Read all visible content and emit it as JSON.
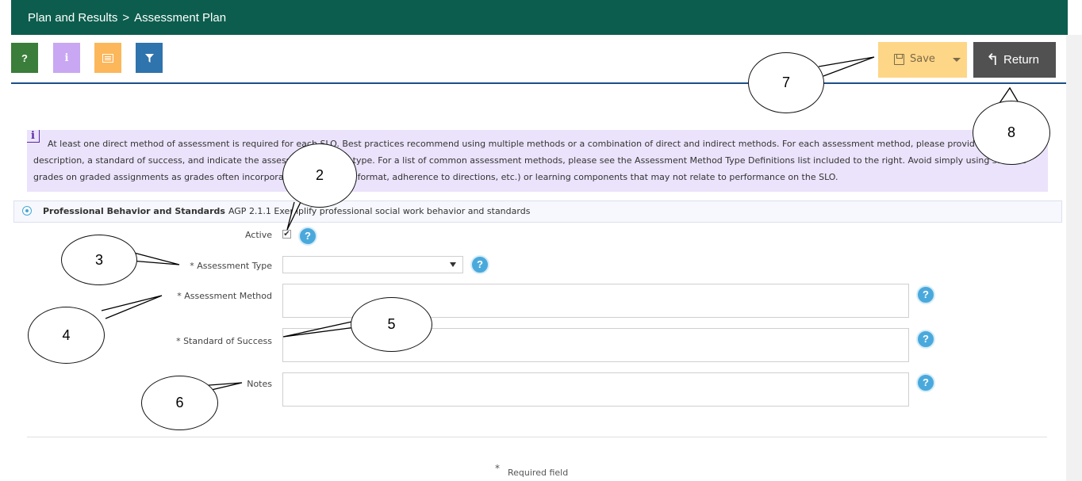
{
  "header": {
    "breadcrumb": [
      "Plan and Results",
      "Assessment Plan"
    ],
    "separator": ">"
  },
  "toolbar": {
    "help_label": "?",
    "info_label": "i",
    "list_icon": "list-icon",
    "filter_icon": "filter-icon",
    "save_label": "Save",
    "return_label": "Return"
  },
  "info": {
    "text": "At least one direct method of assessment is required for each SLO. Best practices recommend using multiple methods or a combination of direct and indirect methods. For each assessment method, please provide a detailed description, a standard of success, and indicate the assessment method type. For a list of common assessment methods, please see the Assessment Method Type Definitions list included to the right. Avoid simply using student grades on graded assignments as grades often incorporate other factors (format, adherence to directions, etc.) or learning components that may not relate to performance on the SLO."
  },
  "slo": {
    "name": "Professional Behavior and Standards",
    "description": "AGP 2.1.1 Exemplify professional social work behavior and standards"
  },
  "form": {
    "active_label": "Active",
    "active_checked": true,
    "assessment_type_label": "* Assessment Type",
    "assessment_type_value": "",
    "assessment_method_label": "Assessment Method",
    "assessment_method_star": "*",
    "standard_label": "* Standard of Success",
    "notes_label": "Notes",
    "help_glyph": "?",
    "required_note": "Required field",
    "required_star": "*"
  },
  "callouts": [
    "2",
    "3",
    "4",
    "5",
    "6",
    "7",
    "8"
  ],
  "colors": {
    "header": "#0c5d4d",
    "help_button": "#3b7d3a",
    "info_button": "#c9a7f2",
    "list_button": "#fcb75b",
    "filter_button": "#2f74ad",
    "save_button": "#fed687",
    "return_button": "#515151",
    "info_background": "#ebe3fb"
  }
}
